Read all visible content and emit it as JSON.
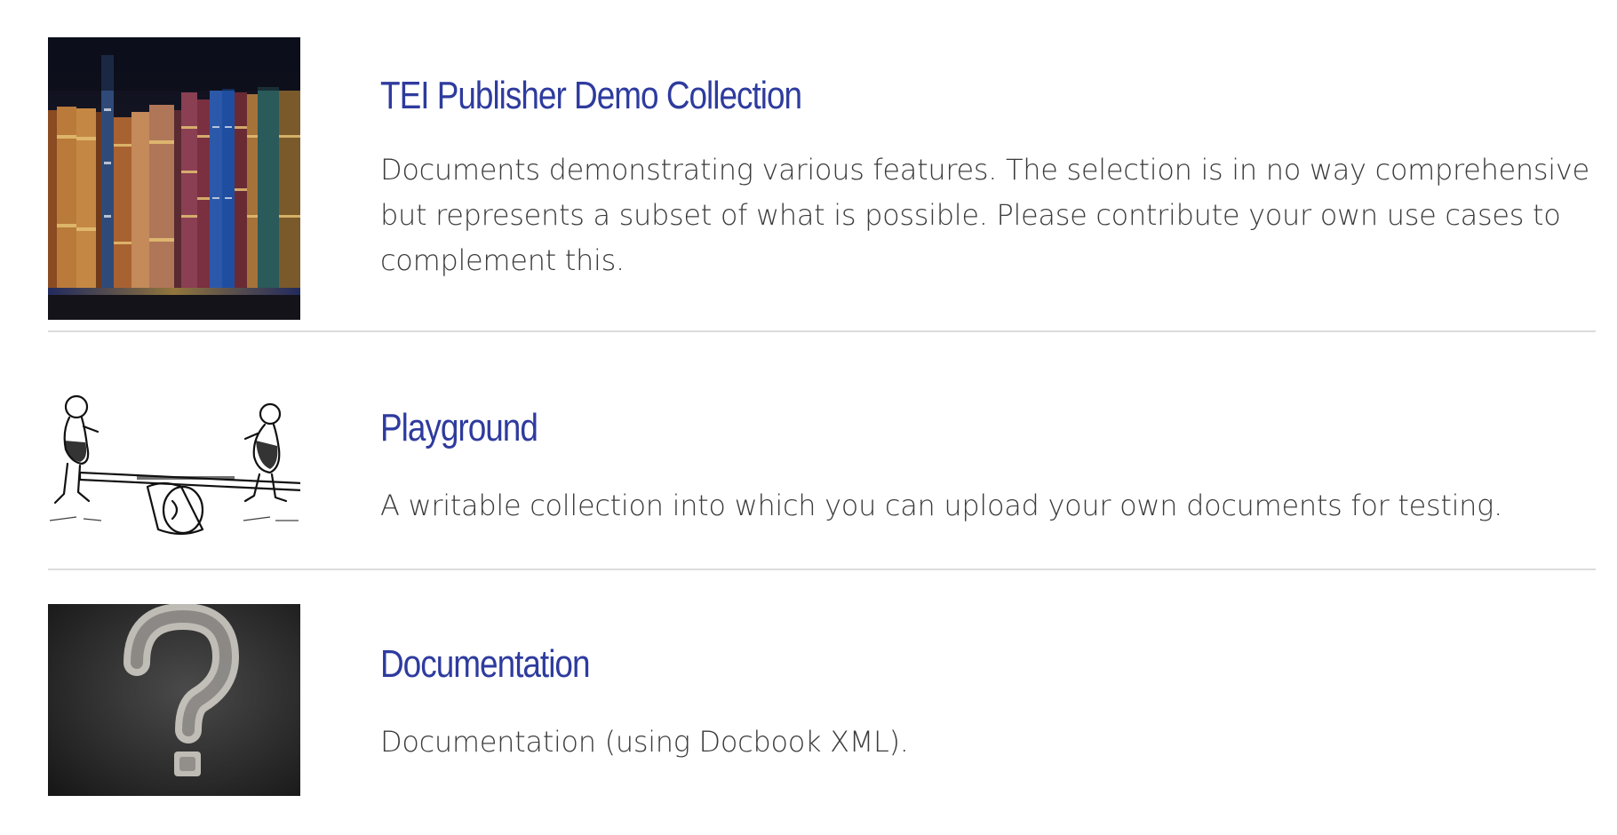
{
  "collections": [
    {
      "title": "TEI Publisher Demo Collection",
      "description": "Documents demonstrating various features. The selection is in no way comprehensive but represents a subset of what is possible. Please contribute your own use cases to complement this.",
      "image": "bookshelf-image"
    },
    {
      "title": "Playground",
      "description": "A writable collection into which you can upload your own documents for testing.",
      "image": "seesaw-image"
    },
    {
      "title": "Documentation",
      "description": "Documentation (using Docbook XML).",
      "image": "question-mark-image"
    }
  ],
  "colors": {
    "title": "#2e3b9e",
    "text": "#3b3b3b",
    "divider": "#dcdcdc"
  }
}
